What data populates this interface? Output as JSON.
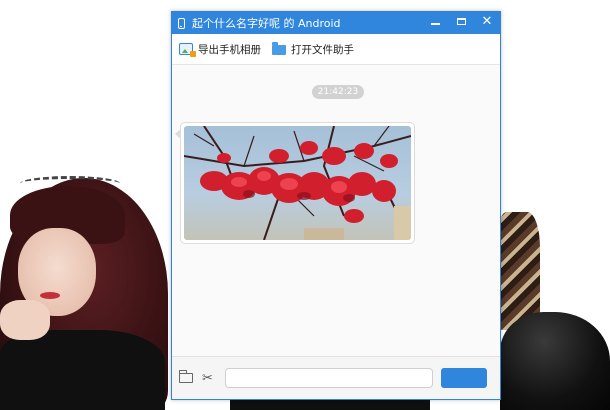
{
  "window": {
    "title": "起个什么名字好呢 的 Android",
    "controls": {
      "minimize": "",
      "maximize": "",
      "close": "✕"
    }
  },
  "toolbar": {
    "export_album_label": "导出手机相册",
    "open_file_assistant_label": "打开文件助手"
  },
  "chat": {
    "timestamp": "21:42:23",
    "message_image": "flower-photo"
  },
  "input_bar": {
    "message_value": "",
    "send_label": ""
  },
  "icons": {
    "title": "phone-icon",
    "export": "export-album-icon",
    "open_file": "folder-icon",
    "attach": "folder-icon",
    "screenshot": "scissors-icon"
  },
  "colors": {
    "accent": "#2f86dc",
    "timestamp_badge": "#d2d2d2",
    "chat_bg": "#fafafa"
  }
}
